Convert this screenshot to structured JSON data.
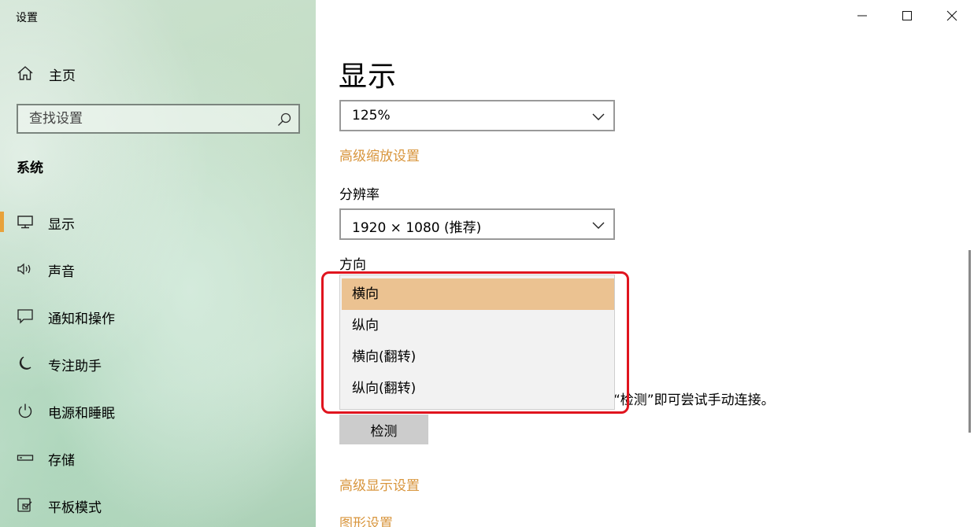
{
  "window": {
    "title": "设置"
  },
  "sidebar": {
    "home_label": "主页",
    "search_placeholder": "查找设置",
    "section_title": "系统",
    "items": [
      {
        "label": "显示",
        "icon": "monitor-icon",
        "active": true
      },
      {
        "label": "声音",
        "icon": "speaker-icon",
        "active": false
      },
      {
        "label": "通知和操作",
        "icon": "notification-icon",
        "active": false
      },
      {
        "label": "专注助手",
        "icon": "moon-icon",
        "active": false
      },
      {
        "label": "电源和睡眠",
        "icon": "power-icon",
        "active": false
      },
      {
        "label": "存储",
        "icon": "storage-icon",
        "active": false
      },
      {
        "label": "平板模式",
        "icon": "tablet-mode-icon",
        "active": false
      }
    ]
  },
  "main": {
    "page_title": "显示",
    "scale": {
      "value": "125%"
    },
    "advanced_scaling_link": "高级缩放设置",
    "resolution": {
      "label": "分辨率",
      "value": "1920 × 1080 (推荐)"
    },
    "orientation": {
      "label": "方向",
      "options": [
        "横向",
        "纵向",
        "横向(翻转)",
        "纵向(翻转)"
      ],
      "selected_index": 0
    },
    "detect_hint": "“检测”即可尝试手动连接。",
    "detect_button": "检测",
    "advanced_display_link": "高级显示设置",
    "graphics_link": "图形设置"
  },
  "colors": {
    "accent": "#e8a23b",
    "link": "#d8953c",
    "selected_option": "#ebc291",
    "highlight_box": "#e0141e"
  }
}
